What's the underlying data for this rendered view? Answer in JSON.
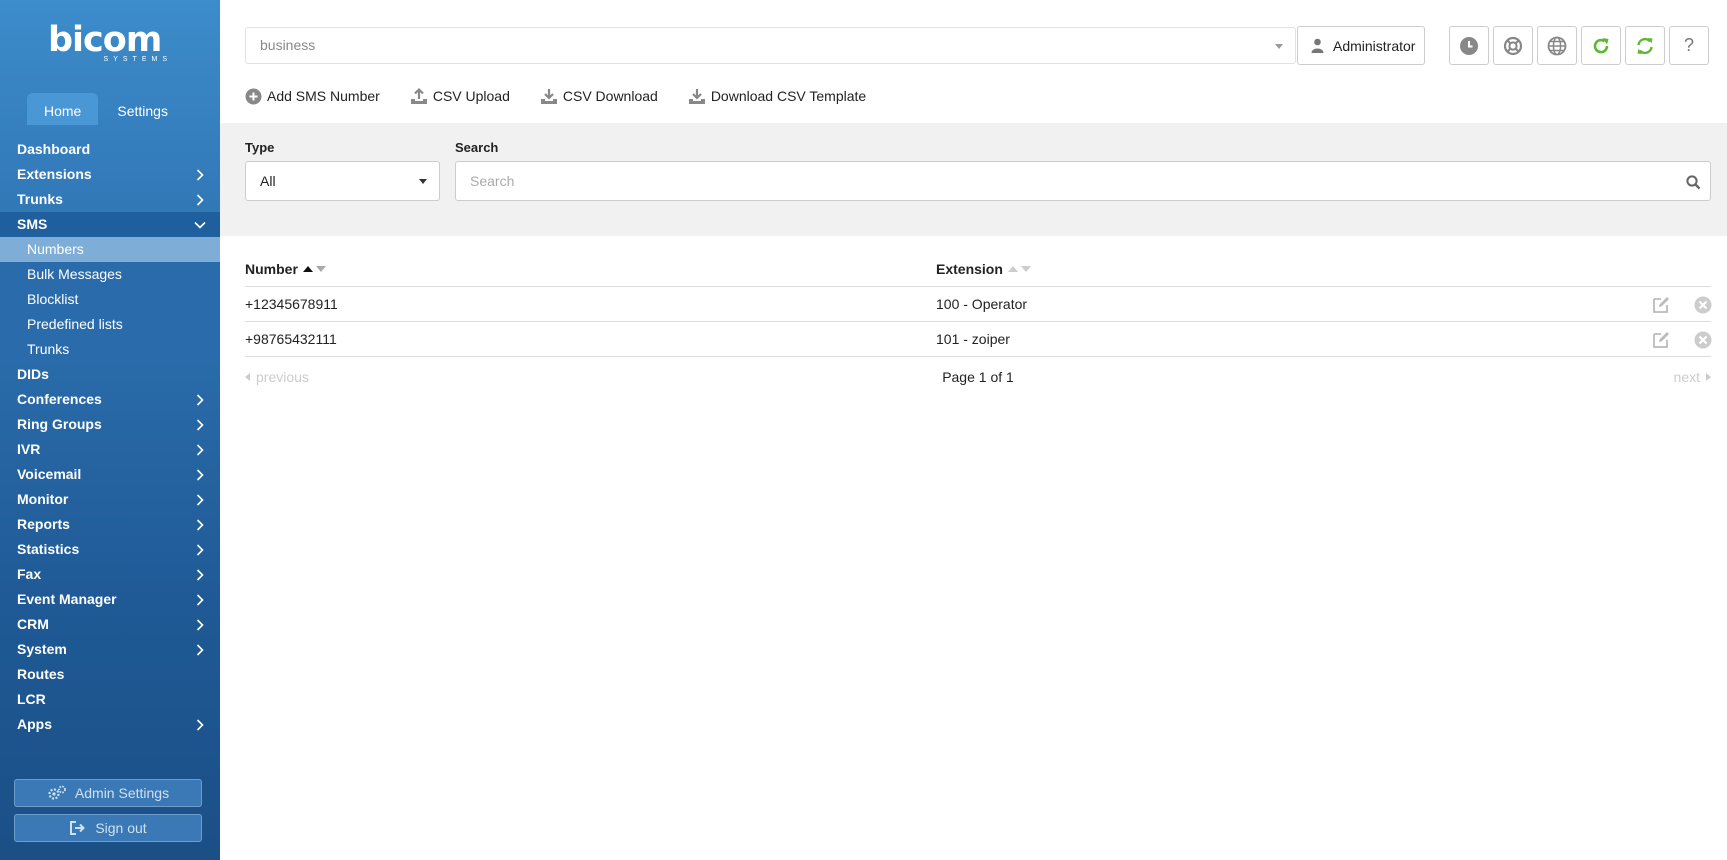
{
  "brand": {
    "name": "bicom",
    "tagline": "SYSTEMS"
  },
  "tabs": [
    {
      "label": "Home"
    },
    {
      "label": "Settings"
    }
  ],
  "menu": {
    "items": [
      {
        "label": "Dashboard"
      },
      {
        "label": "Extensions"
      },
      {
        "label": "Trunks"
      },
      {
        "label": "SMS"
      },
      {
        "label": "Numbers"
      },
      {
        "label": "Bulk Messages"
      },
      {
        "label": "Blocklist"
      },
      {
        "label": "Predefined lists"
      },
      {
        "label": "Trunks"
      },
      {
        "label": "DIDs"
      },
      {
        "label": "Conferences"
      },
      {
        "label": "Ring Groups"
      },
      {
        "label": "IVR"
      },
      {
        "label": "Voicemail"
      },
      {
        "label": "Monitor"
      },
      {
        "label": "Reports"
      },
      {
        "label": "Statistics"
      },
      {
        "label": "Fax"
      },
      {
        "label": "Event Manager"
      },
      {
        "label": "CRM"
      },
      {
        "label": "System"
      },
      {
        "label": "Routes"
      },
      {
        "label": "LCR"
      },
      {
        "label": "Apps"
      }
    ]
  },
  "sidebar_buttons": {
    "admin_settings": "Admin Settings",
    "sign_out": "Sign out"
  },
  "header": {
    "tenant_value": "business",
    "user_label": "Administrator",
    "icons": [
      "clock-icon",
      "support-icon",
      "globe-icon",
      "refresh-icon",
      "sync-icon",
      "help-icon"
    ],
    "help_glyph": "?"
  },
  "toolbar": {
    "add": "Add SMS Number",
    "csv_upload": "CSV Upload",
    "csv_download": "CSV Download",
    "csv_template": "Download CSV Template"
  },
  "filters": {
    "type_label": "Type",
    "type_value": "All",
    "search_label": "Search",
    "search_placeholder": "Search"
  },
  "table": {
    "columns": {
      "number": "Number",
      "extension": "Extension"
    },
    "rows": [
      {
        "number": "+12345678911",
        "extension": "100 - Operator"
      },
      {
        "number": "+98765432111",
        "extension": "101 - zoiper"
      }
    ]
  },
  "pager": {
    "previous": "previous",
    "info": "Page 1 of 1",
    "next": "next"
  },
  "colors": {
    "sidebar_top": "#3d8ccb",
    "sidebar_bottom": "#1b4f86",
    "active_sub": "#7eaed8",
    "green": "#5cb82e"
  }
}
